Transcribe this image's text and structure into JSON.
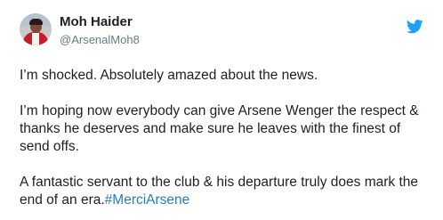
{
  "author": {
    "name": "Moh Haider",
    "handle": "@ArsenalMoh8"
  },
  "icons": {
    "avatar": "avatar-photo",
    "logo": "twitter-bird-icon"
  },
  "colors": {
    "text": "#1c2022",
    "handle": "#697882",
    "link": "#2b7bb9",
    "twitter_blue": "#1da1f2"
  },
  "tweet": {
    "p1": "I’m shocked. Absolutely amazed about the news.",
    "p2": "I’m hoping now everybody can give Arsene Wenger the respect & thanks he deserves and make sure he leaves with the finest of send offs.",
    "p3_text": "A fantastic servant to the club & his departure truly does mark the end of an era.",
    "p3_hashtag": "#MerciArsene"
  }
}
